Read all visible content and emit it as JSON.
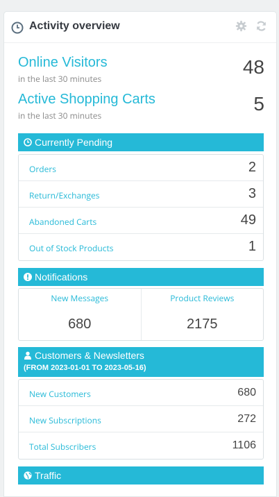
{
  "panel": {
    "title": "Activity overview",
    "icons": {
      "clock": "clock-icon",
      "gear": "gear-icon",
      "refresh": "refresh-icon"
    }
  },
  "metrics": {
    "online": {
      "label": "Online Visitors",
      "sub": "in the last 30 minutes",
      "value": "48"
    },
    "carts": {
      "label": "Active Shopping Carts",
      "sub": "in the last 30 minutes",
      "value": "5"
    }
  },
  "pending": {
    "title": "Currently Pending",
    "items": [
      {
        "label": "Orders",
        "value": "2"
      },
      {
        "label": "Return/Exchanges",
        "value": "3"
      },
      {
        "label": "Abandoned Carts",
        "value": "49"
      },
      {
        "label": "Out of Stock Products",
        "value": "1"
      }
    ]
  },
  "notifications": {
    "title": "Notifications",
    "items": [
      {
        "label": "New Messages",
        "value": "680"
      },
      {
        "label": "Product Reviews",
        "value": "2175"
      }
    ]
  },
  "customers": {
    "title": "Customers & Newsletters",
    "range": "(FROM 2023-01-01 TO 2023-05-16)",
    "items": [
      {
        "label": "New Customers",
        "value": "680"
      },
      {
        "label": "New Subscriptions",
        "value": "272"
      },
      {
        "label": "Total Subscribers",
        "value": "1106"
      }
    ]
  },
  "traffic": {
    "title": "Traffic"
  },
  "colors": {
    "accent": "#25b9d7",
    "title": "#363a41",
    "icon": "#c7ccd0"
  }
}
